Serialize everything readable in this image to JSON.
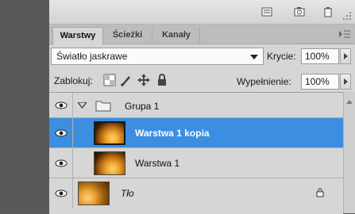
{
  "panel": {
    "tabs": [
      {
        "label": "Warstwy",
        "active": true
      },
      {
        "label": "Ścieżki",
        "active": false
      },
      {
        "label": "Kanały",
        "active": false
      }
    ],
    "blend_mode": "Światło jaskrawe",
    "opacity_label": "Krycie:",
    "opacity_value": "100%",
    "lock_label": "Zablokuj:",
    "fill_label": "Wypełnienie:",
    "fill_value": "100%"
  },
  "layers": [
    {
      "name": "Grupa 1",
      "type": "group",
      "expanded": true
    },
    {
      "name": "Warstwa 1 kopia",
      "type": "layer",
      "selected": true
    },
    {
      "name": "Warstwa 1",
      "type": "layer",
      "selected": false
    },
    {
      "name": "Tło",
      "type": "background",
      "locked": true
    }
  ],
  "colors": {
    "selection": "#3b8ee0",
    "panel_bg": "#d6d6d6"
  }
}
